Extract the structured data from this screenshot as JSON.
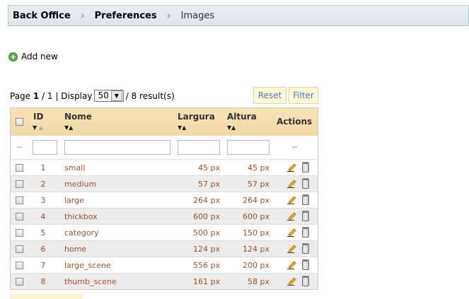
{
  "breadcrumb": {
    "items": [
      "Back Office",
      "Preferences",
      "Images"
    ]
  },
  "actions": {
    "add_new": "Add new"
  },
  "pager": {
    "page_label": "Page",
    "current": "1",
    "total_sep": "/ 1 | Display",
    "per_page": "50",
    "results": "/ 8 result(s)"
  },
  "buttons": {
    "reset": "Reset",
    "filter": "Filter"
  },
  "table": {
    "headers": {
      "id": "ID",
      "name": "Nome",
      "width": "Largura",
      "height": "Altura",
      "actions": "Actions"
    },
    "filter_dash_left": "--",
    "filter_dash_right": "--",
    "rows": [
      {
        "id": "1",
        "name": "small",
        "width": "45 px",
        "height": "45 px"
      },
      {
        "id": "2",
        "name": "medium",
        "width": "57 px",
        "height": "57 px"
      },
      {
        "id": "3",
        "name": "large",
        "width": "264 px",
        "height": "264 px"
      },
      {
        "id": "4",
        "name": "thickbox",
        "width": "600 px",
        "height": "600 px"
      },
      {
        "id": "5",
        "name": "category",
        "width": "500 px",
        "height": "150 px"
      },
      {
        "id": "6",
        "name": "home",
        "width": "124 px",
        "height": "124 px"
      },
      {
        "id": "7",
        "name": "large_scene",
        "width": "556 px",
        "height": "200 px"
      },
      {
        "id": "8",
        "name": "thumb_scene",
        "width": "161 px",
        "height": "58 px"
      }
    ]
  },
  "colors": {
    "link": "#a0522d",
    "header_bg": "#f3d9a7",
    "button_text": "#4a7bb7"
  }
}
